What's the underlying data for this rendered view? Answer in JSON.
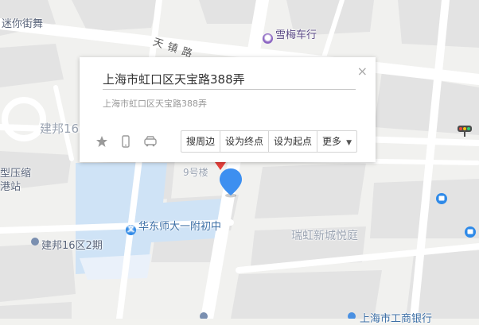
{
  "map": {
    "labels": {
      "mimi_shop": "迷你街舞",
      "tianzhen_road": "天镇路",
      "xuemei_shop": "雪梅车行",
      "jianbang16_top": "建邦16",
      "yasuo_station_1": "型压缩",
      "yasuo_station_2": "港站",
      "building9": "9号楼",
      "ecnu_school": "华东师大一附初中",
      "jianbang16_phase2": "建邦16区2期",
      "ruihong": "瑞虹新城悦庭",
      "bank_bottom": "上海市工商银行"
    },
    "icons": {
      "school": "文"
    }
  },
  "popup": {
    "title": "上海市虹口区天宝路388弄",
    "address": "上海市虹口区天宝路388弄",
    "close_label": "×",
    "actions": {
      "nearby": "搜周边",
      "set_end": "设为终点",
      "set_start": "设为起点",
      "more": "更多"
    }
  },
  "colors": {
    "water": "#cfe3f6",
    "block": "#e2e2e2",
    "road": "#ffffff",
    "marker": "#3d8ff0",
    "poi_purple": "#8a63c2",
    "transit_blue": "#2f8ae8"
  }
}
